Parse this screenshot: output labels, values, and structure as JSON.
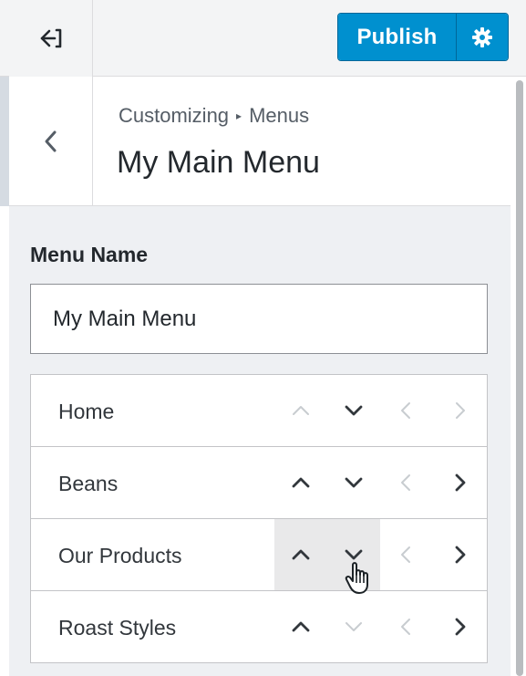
{
  "header": {
    "publish_label": "Publish"
  },
  "section": {
    "breadcrumb_parent": "Customizing",
    "breadcrumb_separator": "▸",
    "breadcrumb_current": "Menus",
    "title": "My Main Menu"
  },
  "menu_name": {
    "label": "Menu Name",
    "value": "My Main Menu"
  },
  "menu_items": [
    {
      "label": "Home",
      "up_enabled": false,
      "down_enabled": true,
      "left_enabled": false,
      "right_enabled": false
    },
    {
      "label": "Beans",
      "up_enabled": true,
      "down_enabled": true,
      "left_enabled": false,
      "right_enabled": true
    },
    {
      "label": "Our Products",
      "up_enabled": true,
      "down_enabled": true,
      "left_enabled": false,
      "right_enabled": true
    },
    {
      "label": "Roast Styles",
      "up_enabled": true,
      "down_enabled": false,
      "left_enabled": false,
      "right_enabled": true
    }
  ],
  "colors": {
    "primary_button": "#0090cf",
    "arrow_enabled": "#32373c",
    "arrow_disabled": "#c8ccd0"
  }
}
